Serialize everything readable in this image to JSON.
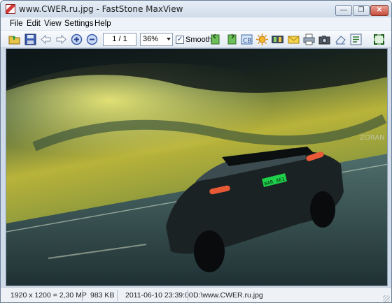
{
  "window": {
    "title": "www.CWER.ru.jpg - FastStone MaxView",
    "minimize_label": "—",
    "maximize_label": "❐",
    "close_label": "✕"
  },
  "menu": {
    "items": [
      "File",
      "Edit",
      "View",
      "Settings",
      "Help"
    ]
  },
  "toolbar": {
    "page_value": "1 / 1",
    "zoom_value": "36%",
    "smooth_label": "Smooth",
    "smooth_checked": "✓",
    "icons": [
      "open-folder-icon",
      "save-icon",
      "back-arrow-icon",
      "forward-arrow-icon",
      "zoom-in-icon",
      "zoom-out-icon",
      "rotate-left-icon",
      "rotate-right-icon",
      "text-icon",
      "brightness-icon",
      "filmstrip-icon",
      "email-icon",
      "print-icon",
      "camera-icon",
      "eraser-icon",
      "settings-icon",
      "fullscreen-icon"
    ]
  },
  "image": {
    "watermark": "ZORAN",
    "plate_text": "WAR 461"
  },
  "status": {
    "dimensions": "1920 x 1200 = 2,30 MP",
    "filesize": "983 KB",
    "datetime": "2011-06-10 23:39:00",
    "path": "D:\\www.CWER.ru.jpg"
  },
  "colors": {
    "accent": "#cfdbe9",
    "sky_yellow": "#c8c43a",
    "sky_dark": "#2a4238",
    "road": "#3d5a5e"
  }
}
